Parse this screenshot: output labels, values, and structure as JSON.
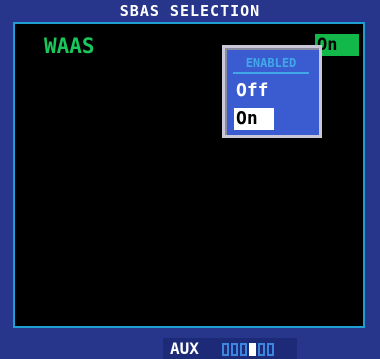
{
  "header": {
    "title": "SBAS SELECTION"
  },
  "setting": {
    "label": "WAAS",
    "value": "On"
  },
  "popup": {
    "header": "ENABLED",
    "options": [
      "Off",
      "On"
    ],
    "selected": "On"
  },
  "footer": {
    "label": "AUX",
    "page_count": 6,
    "active_page": 4
  },
  "colors": {
    "background": "#27358a",
    "panel": "#000000",
    "accent_green": "#19c85a",
    "popup_blue": "#3b5bd0",
    "popup_header": "#40a8e8"
  }
}
